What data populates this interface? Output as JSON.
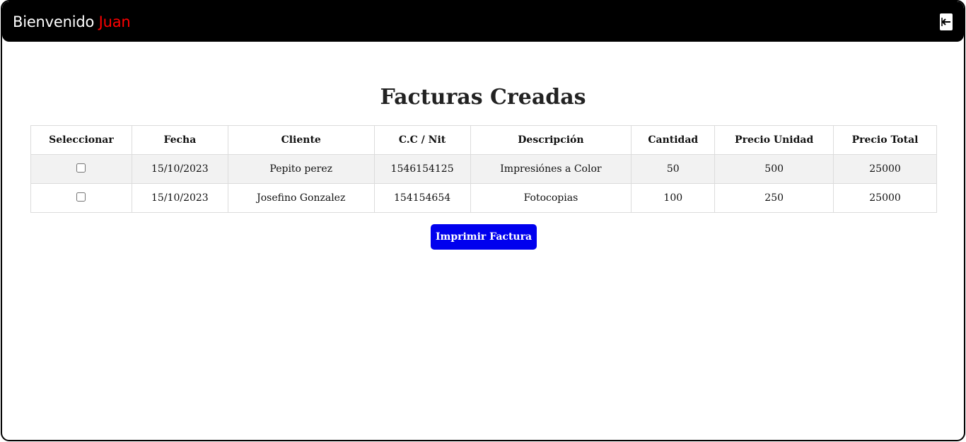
{
  "header": {
    "welcome_text": "Bienvenido",
    "user_name": "Juan",
    "logout_icon": "logout-arrow-icon"
  },
  "page": {
    "title": "Facturas Creadas"
  },
  "table": {
    "headers": [
      "Seleccionar",
      "Fecha",
      "Cliente",
      "C.C / Nit",
      "Descripción",
      "Cantidad",
      "Precio Unidad",
      "Precio Total"
    ],
    "rows": [
      {
        "selected": false,
        "fecha": "15/10/2023",
        "cliente": "Pepito perez",
        "nit": "1546154125",
        "descripcion": "Impresiónes a Color",
        "cantidad": "50",
        "precio_unidad": "500",
        "precio_total": "25000"
      },
      {
        "selected": false,
        "fecha": "15/10/2023",
        "cliente": "Josefino Gonzalez",
        "nit": "154154654",
        "descripcion": "Fotocopias",
        "cantidad": "100",
        "precio_unidad": "250",
        "precio_total": "25000"
      }
    ]
  },
  "actions": {
    "print_label": "Imprimir Factura"
  },
  "colors": {
    "topbar": "#000000",
    "user_name": "#ff0000",
    "print_button": "#0000ee"
  }
}
